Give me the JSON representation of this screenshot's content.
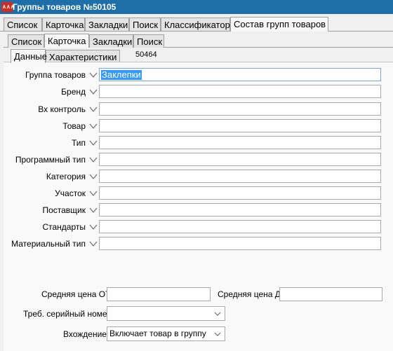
{
  "window": {
    "title": "Группы товаров №50105",
    "icon": "app-logo-icon"
  },
  "main_tabs": [
    "Список",
    "Карточка",
    "Закладки",
    "Поиск",
    "Классификатор",
    "Состав групп товаров"
  ],
  "sub_tabs": [
    "Список",
    "Карточка",
    "Закладки",
    "Поиск"
  ],
  "inner_tabs": [
    "Данные",
    "Характеристики"
  ],
  "record_code": "50464",
  "fields": [
    {
      "label": "Группа товаров",
      "value": "Заклепки"
    },
    {
      "label": "Бренд",
      "value": ""
    },
    {
      "label": "Вх контроль",
      "value": ""
    },
    {
      "label": "Товар",
      "value": ""
    },
    {
      "label": "Тип",
      "value": ""
    },
    {
      "label": "Программный тип",
      "value": ""
    },
    {
      "label": "Категория",
      "value": ""
    },
    {
      "label": "Участок",
      "value": ""
    },
    {
      "label": "Поставщик",
      "value": ""
    },
    {
      "label": "Стандарты",
      "value": ""
    },
    {
      "label": "Материальный тип",
      "value": ""
    }
  ],
  "price": {
    "from_label": "Средняя цена ОТ",
    "from_value": "",
    "to_label": "Средняя цена ДО",
    "to_value": ""
  },
  "serial": {
    "label": "Треб. серийный номер",
    "value": ""
  },
  "inclusion": {
    "label": "Вхождение",
    "value": "Включает товар в группу"
  },
  "colors": {
    "titlebar": "#1e6ea8",
    "selection": "#3399ff",
    "app_icon": "#d42b1e"
  }
}
